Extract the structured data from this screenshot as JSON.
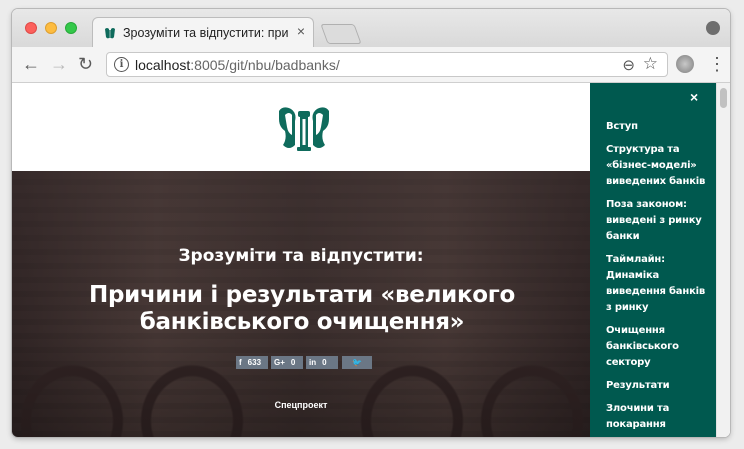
{
  "browser": {
    "tab_title": "Зрозуміти та відпустити: при",
    "tab_close": "×",
    "url_host": "localhost",
    "url_rest": ":8005/git/nbu/badbanks/",
    "back_icon": "←",
    "forward_icon": "→",
    "reload_icon": "↻",
    "zoom_icon": "⊖",
    "star_icon": "☆",
    "menu_icon": "⋮",
    "info_icon": "i"
  },
  "hero": {
    "subtitle": "Зрозуміти та відпустити:",
    "title": "Причини і результати «великого банківського очищення»",
    "special": "Спецпроект"
  },
  "share": {
    "facebook": {
      "icon": "f",
      "count": "633"
    },
    "google": {
      "icon": "G+",
      "count": "0"
    },
    "linkedin": {
      "icon": "in",
      "count": "0"
    },
    "twitter": {
      "icon": "🐦"
    }
  },
  "sidebar": {
    "close": "×",
    "items": [
      "Вступ",
      "Структура та «бізнес-моделі» виведених банків",
      "Поза законом: виведені з ринку банки",
      "Таймлайн: Динаміка виведення банків з ринку",
      "Очищення банківського сектору",
      "Результати",
      "Злочини та покарання"
    ]
  },
  "colors": {
    "sidebar_bg": "#00594f",
    "logo_green": "#0f6b5c",
    "share_bg": "#6b7785"
  }
}
